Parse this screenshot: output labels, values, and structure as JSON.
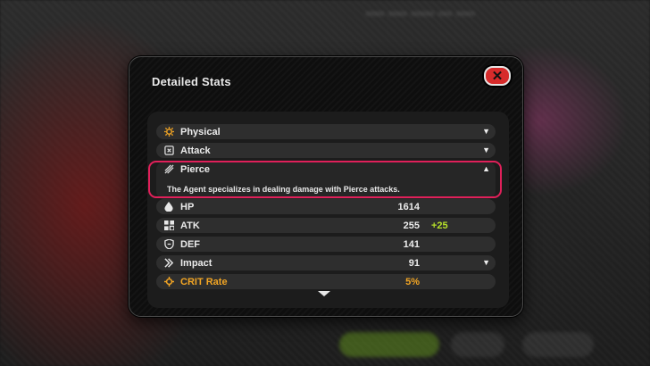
{
  "modal": {
    "title": "Detailed Stats",
    "close_icon": "close-x-icon"
  },
  "groups": [
    {
      "label": "Physical",
      "icon": "sun-gear-icon",
      "chevron": "▼"
    },
    {
      "label": "Attack",
      "icon": "target-icon",
      "chevron": "▼"
    },
    {
      "label": "Pierce",
      "icon": "pierce-icon",
      "chevron": "▲",
      "description": "The Agent specializes in dealing damage with Pierce attacks."
    }
  ],
  "stats": [
    {
      "label": "HP",
      "icon": "droplet-icon",
      "value": "1614",
      "bonus": ""
    },
    {
      "label": "ATK",
      "icon": "atk-icon",
      "value": "255",
      "bonus": "+25"
    },
    {
      "label": "DEF",
      "icon": "shield-icon",
      "value": "141",
      "bonus": ""
    },
    {
      "label": "Impact",
      "icon": "impact-icon",
      "value": "91",
      "bonus": "",
      "chevron": "▼"
    },
    {
      "label": "CRIT Rate",
      "icon": "crit-icon",
      "value": "5%",
      "bonus": ""
    }
  ],
  "colors": {
    "accent_highlight": "#e0205a",
    "bonus_green": "#b6e02a",
    "crit_orange": "#f2a524",
    "close_red": "#d72b2b"
  }
}
